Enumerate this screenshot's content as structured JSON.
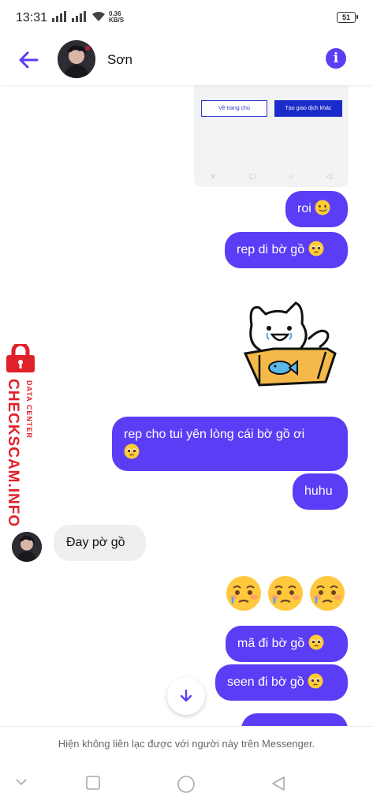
{
  "status_bar": {
    "time": "13:31",
    "net_speed_value": "0.36",
    "net_speed_unit": "KB/S",
    "battery": "51"
  },
  "header": {
    "contact_name": "Sơn",
    "info_glyph": "i"
  },
  "shared_card": {
    "button_left": "Về trang chủ",
    "button_right": "Tạo giao dịch khác",
    "nav_icons": [
      "chevron-down-icon",
      "square-icon",
      "circle-icon",
      "triangle-back-icon"
    ]
  },
  "messages": {
    "m1": "roi",
    "m2": "rep di bờ gồ",
    "m3_line1": "rep cho tui yên lòng cái bờ gồ ơi",
    "m4": "huhu",
    "m5": "Đay pờ gồ",
    "m6": "mã đi bờ gồ",
    "m7": "seen đi bờ gồ"
  },
  "watermark": {
    "main": "CHECKSCAM.INFO",
    "sub": "DATA CENTER"
  },
  "notice": "Hiện không liên lạc được với người này trên Messenger.",
  "colors": {
    "accent": "#5b3df5",
    "incoming_bubble": "#efefef",
    "watermark_red": "#e0202a"
  }
}
